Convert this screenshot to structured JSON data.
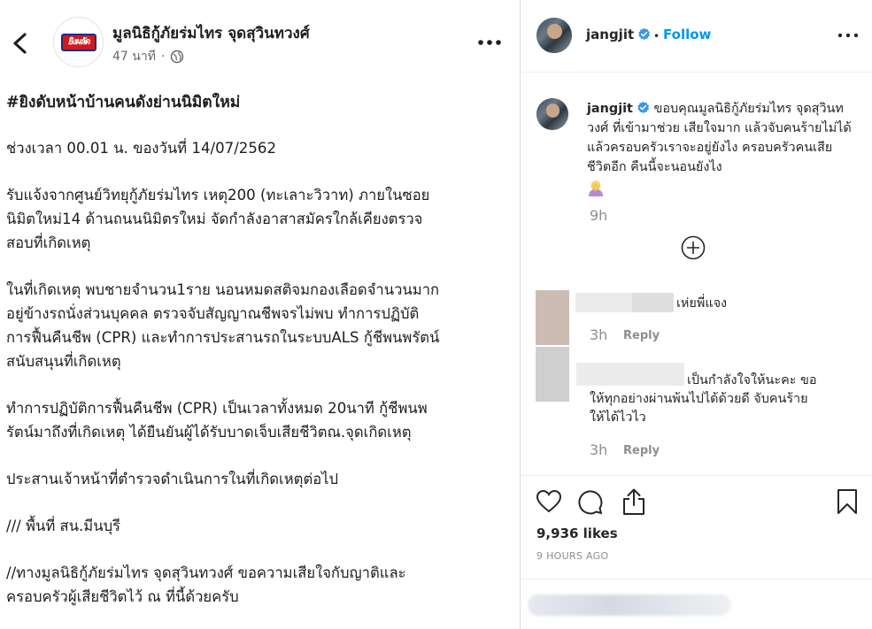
{
  "facebook_post": {
    "page_name": "มูลนิธิกู้ภัยร่มไทร จุดสุวินทวงศ์",
    "logo_text": "ยิงผลัด",
    "timestamp": "47 นาที",
    "separator": "·",
    "paragraphs": [
      "#ยิงดับหน้าบ้านคนดังย่านนิมิตใหม่",
      "ช่วงเวลา 00.01 น. ของวันที่ 14/07/2562",
      "รับแจ้งจากศูนย์วิทยุกู้ภัยร่มไทร เหตุ200 (ทะเลาะวิวาท) ภายในซอย\nนิมิตใหม่14 ด้านถนนนิมิตรใหม่ จัดกำลังอาสาสมัครใกล้เคียงตรวจ\nสอบที่เกิดเหตุ",
      "ในที่เกิดเหตุ พบชายจำนวน1ราย นอนหมดสติจมกองเลือดจำนวนมาก\nอยู่ข้างรถนั่งส่วนบุคคล ตรวจจับสัญญาณชีพจรไม่พบ ทำการปฏิบัติ\nการฟื้นคืนชีพ (CPR) และทำการประสานรถในระบบALS กู้ชีพนพรัตน์\nสนับสนุนที่เกิดเหตุ",
      "ทำการปฏิบัติการฟื้นคืนชีพ (CPR) เป็นเวลาทั้งหมด 20นาที กู้ชีพนพ\nรัตน์มาถึงที่เกิดเหตุ ได้ยืนยันผู้ได้รับบาดเจ็บเสียชีวิตณ.จุดเกิดเหตุ",
      "ประสานเจ้าหน้าที่ตำรวจดำเนินการในที่เกิดเหตุต่อไป",
      "/// พื้นที่ สน.มีนบุรี",
      "//ทางมูลนิธิกู้ภัยร่มไทร จุดสุวินทวงศ์ ขอความเสียใจกับญาติและ\nครอบครัวผู้เสียชีวิตไว้ ณ ที่นี้ด้วยครับ"
    ],
    "icons": {
      "back": "chevron-left-icon",
      "more": "more-horizontal-icon",
      "audience": "globe-icon"
    }
  },
  "instagram_post": {
    "username": "jangjit",
    "bullet": "•",
    "follow_label": "Follow",
    "caption": "ขอบคุณมูลนิธิกู้ภัยร่มไทร จุดสุวินทวงศ์ ที่เข้ามาช่วย เสียใจมาก แล้วจับคนร้ายไม่ได้ แล้วครอบครัวเราจะอยู่ยังไง ครอบครัวคนเสียชีวิตอีก คืนนี้จะนอนยังไง",
    "caption_time": "9h",
    "comments": [
      {
        "text": "เห่ยพี่แจง",
        "time": "3h",
        "reply_label": "Reply"
      },
      {
        "text_line1": "เป็นกำลังใจให้นะคะ ขอ",
        "text_line2": "ให้ทุกอย่างผ่านพ้นไปได้ด้วยดี จับคนร้าย",
        "text_line3": "ให้ได้ไวไว",
        "time": "3h",
        "reply_label": "Reply"
      }
    ],
    "likes": "9,936 likes",
    "posted_ago": "9 HOURS AGO",
    "accent_color": "#0095f6",
    "icons": [
      "verified-badge-icon",
      "more-horizontal-icon",
      "load-more-plus-icon",
      "heart-icon",
      "comment-icon",
      "share-icon",
      "bookmark-icon",
      "facepalm-emoji-icon"
    ]
  }
}
